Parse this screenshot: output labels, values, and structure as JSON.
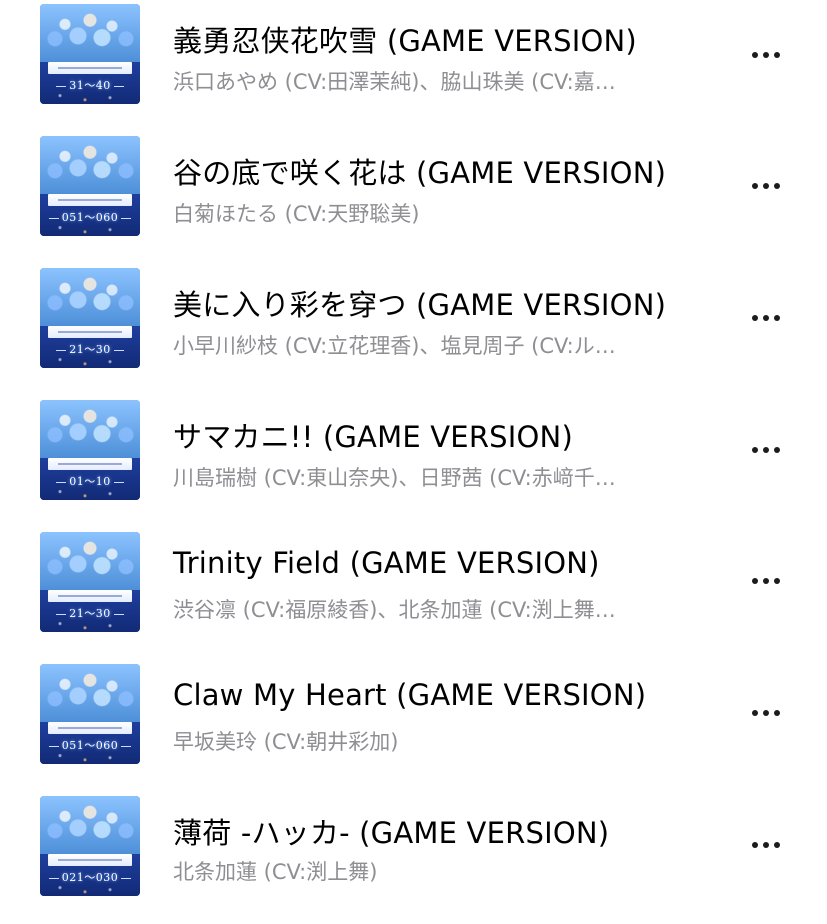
{
  "tracks": [
    {
      "title": "義勇忍侠花吹雪 (GAME VERSION)",
      "artist": "浜口あやめ (CV:田澤茉純)、脇山珠美 (CV:嘉…",
      "artwork_range": "31～40",
      "more_icon": "ellipsis-icon"
    },
    {
      "title": "谷の底で咲く花は (GAME VERSION)",
      "artist": "白菊ほたる (CV:天野聡美)",
      "artwork_range": "051～060",
      "more_icon": "ellipsis-icon"
    },
    {
      "title": "美に入り彩を穿つ (GAME VERSION)",
      "artist": "小早川紗枝 (CV:立花理香)、塩見周子 (CV:ル…",
      "artwork_range": "21～30",
      "more_icon": "ellipsis-icon"
    },
    {
      "title": "サマカニ!! (GAME VERSION)",
      "artist": "川島瑞樹 (CV:東山奈央)、日野茜 (CV:赤﨑千…",
      "artwork_range": "01～10",
      "more_icon": "ellipsis-icon"
    },
    {
      "title": "Trinity Field (GAME VERSION)",
      "artist": "渋谷凛 (CV:福原綾香)、北条加蓮 (CV:渕上舞…",
      "artwork_range": "21～30",
      "more_icon": "ellipsis-icon"
    },
    {
      "title": "Claw My Heart (GAME VERSION)",
      "artist": "早坂美玲 (CV:朝井彩加)",
      "artwork_range": "051～060",
      "more_icon": "ellipsis-icon"
    },
    {
      "title": "薄荷 -ハッカ- (GAME VERSION)",
      "artist": "北条加蓮 (CV:渕上舞)",
      "artwork_range": "021～030",
      "more_icon": "ellipsis-icon"
    }
  ],
  "colors": {
    "title_text": "#000000",
    "artist_text": "#8e8e93",
    "more_dots": "#1c1c1e",
    "background": "#ffffff"
  }
}
